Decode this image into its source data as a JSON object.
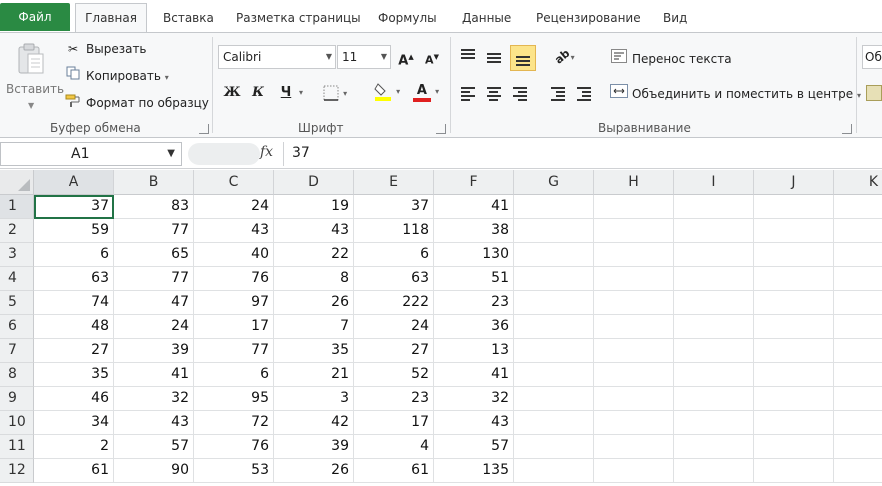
{
  "tabs": {
    "file": "Файл",
    "items": [
      "Главная",
      "Вставка",
      "Разметка страницы",
      "Формулы",
      "Данные",
      "Рецензирование",
      "Вид"
    ]
  },
  "clipboard": {
    "paste": "Вставить",
    "cut": "Вырезать",
    "copy": "Копировать",
    "format_painter": "Формат по образцу",
    "group_label": "Буфер обмена"
  },
  "font": {
    "name": "Calibri",
    "size": "11",
    "bold": "Ж",
    "italic": "К",
    "underline": "Ч",
    "group_label": "Шрифт"
  },
  "alignment": {
    "wrap_text": "Перенос текста",
    "merge_center": "Объединить и поместить в центре",
    "group_label": "Выравнивание"
  },
  "number": {
    "partial_label": "Об"
  },
  "formula_bar": {
    "name_box": "A1",
    "fx": "fx",
    "value": "37"
  },
  "sheet": {
    "columns": [
      "A",
      "B",
      "C",
      "D",
      "E",
      "F",
      "G",
      "H",
      "I",
      "J",
      "K"
    ],
    "rows": [
      "1",
      "2",
      "3",
      "4",
      "5",
      "6",
      "7",
      "8",
      "9",
      "10",
      "11",
      "12"
    ],
    "values": [
      [
        "37",
        "83",
        "24",
        "19",
        "37",
        "41"
      ],
      [
        "59",
        "77",
        "43",
        "43",
        "118",
        "38"
      ],
      [
        "6",
        "65",
        "40",
        "22",
        "6",
        "130"
      ],
      [
        "63",
        "77",
        "76",
        "8",
        "63",
        "51"
      ],
      [
        "74",
        "47",
        "97",
        "26",
        "222",
        "23"
      ],
      [
        "48",
        "24",
        "17",
        "7",
        "24",
        "36"
      ],
      [
        "27",
        "39",
        "77",
        "35",
        "27",
        "13"
      ],
      [
        "35",
        "41",
        "6",
        "21",
        "52",
        "41"
      ],
      [
        "46",
        "32",
        "95",
        "3",
        "23",
        "32"
      ],
      [
        "34",
        "43",
        "72",
        "42",
        "17",
        "43"
      ],
      [
        "2",
        "57",
        "76",
        "39",
        "4",
        "57"
      ],
      [
        "61",
        "90",
        "53",
        "26",
        "61",
        "135"
      ]
    ]
  },
  "colors": {
    "file_tab": "#2a8a43",
    "selection": "#217346",
    "highlight_button": "#fce48a",
    "font_color_bar": "#e02020",
    "fill_color_bar": "#ffff00"
  }
}
